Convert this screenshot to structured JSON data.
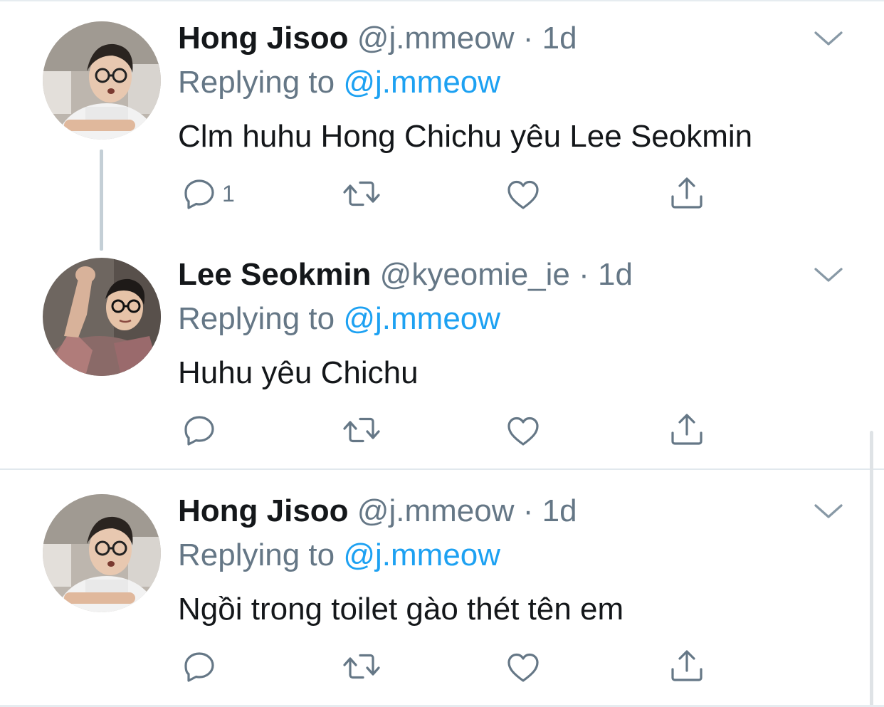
{
  "tweets": [
    {
      "name": "Hong Jisoo",
      "handle": "@j.mmeow",
      "dot": "·",
      "time": "1d",
      "replying_prefix": "Replying to ",
      "replying_to": "@j.mmeow",
      "text": "Clm huhu Hong Chichu yêu Lee Seokmin",
      "reply_count": "1",
      "avatar_icon": "person-photo-avatar"
    },
    {
      "name": "Lee Seokmin",
      "handle": "@kyeomie_ie",
      "dot": "·",
      "time": "1d",
      "replying_prefix": "Replying to ",
      "replying_to": "@j.mmeow",
      "text": "Huhu yêu Chichu",
      "reply_count": "",
      "avatar_icon": "person-photo-avatar"
    },
    {
      "name": "Hong Jisoo",
      "handle": "@j.mmeow",
      "dot": "·",
      "time": "1d",
      "replying_prefix": "Replying to ",
      "replying_to": "@j.mmeow",
      "text": "Ngồi trong toilet gào thét tên em",
      "reply_count": "",
      "avatar_icon": "person-photo-avatar"
    }
  ],
  "icons": {
    "reply": "reply-icon",
    "retweet": "retweet-icon",
    "like": "heart-icon",
    "share": "share-icon",
    "more": "chevron-down-icon"
  },
  "colors": {
    "text": "#14171a",
    "secondary": "#657786",
    "link": "#1da1f2",
    "thread_line": "#c4cfd6",
    "divider": "#e1e8ed"
  }
}
